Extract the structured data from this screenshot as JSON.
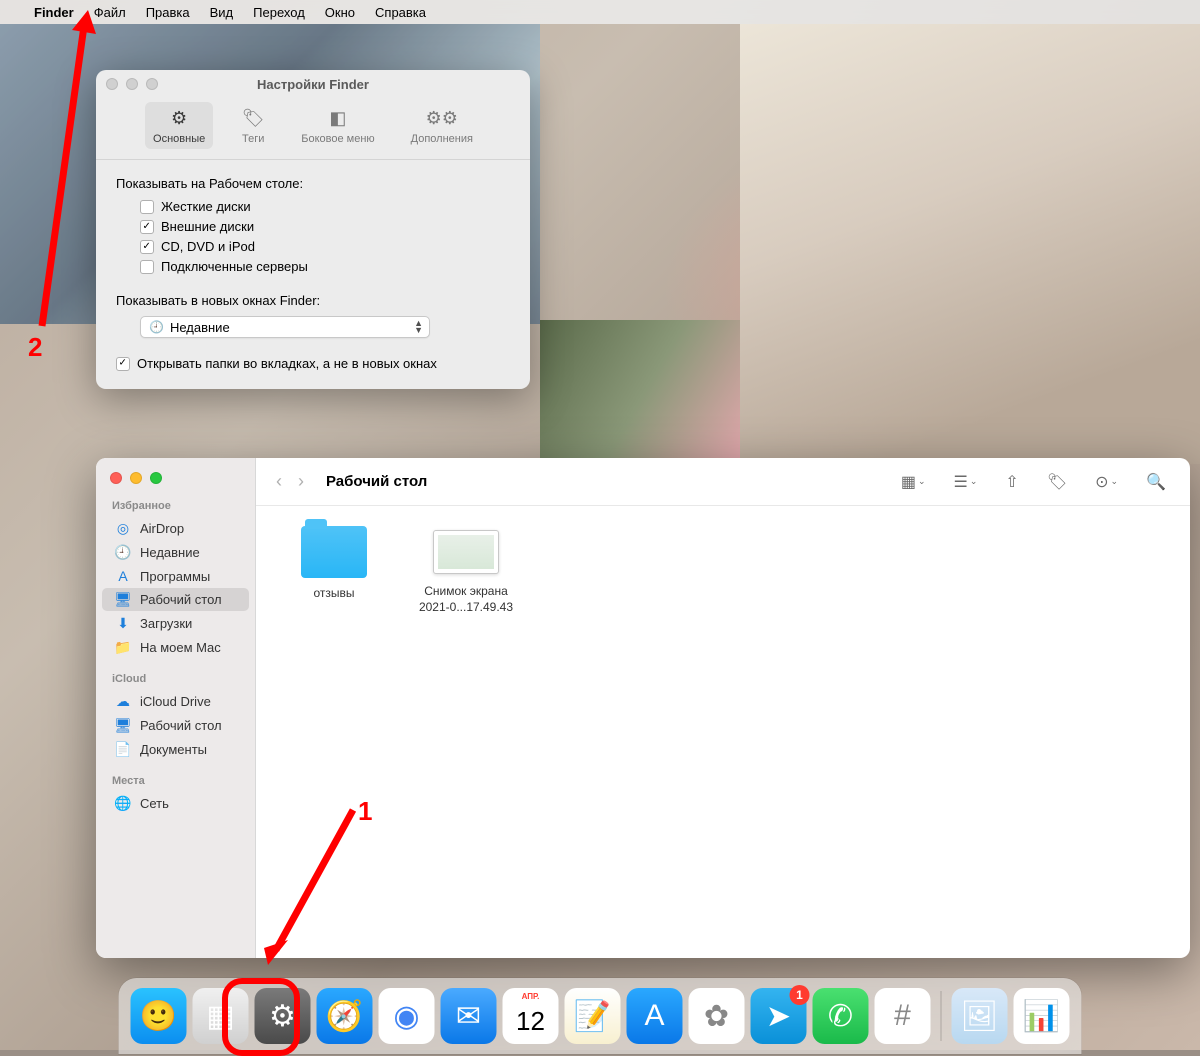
{
  "menubar": {
    "app": "Finder",
    "items": [
      "Файл",
      "Правка",
      "Вид",
      "Переход",
      "Окно",
      "Справка"
    ]
  },
  "prefs": {
    "title": "Настройки Finder",
    "tabs": [
      {
        "id": "general",
        "label": "Основные"
      },
      {
        "id": "tags",
        "label": "Теги"
      },
      {
        "id": "sidebar",
        "label": "Боковое меню"
      },
      {
        "id": "advanced",
        "label": "Дополнения"
      }
    ],
    "show_on_desktop_label": "Показывать на Рабочем столе:",
    "checks": [
      {
        "label": "Жесткие диски",
        "on": false
      },
      {
        "label": "Внешние диски",
        "on": true
      },
      {
        "label": "CD, DVD и iPod",
        "on": true
      },
      {
        "label": "Подключенные серверы",
        "on": false
      }
    ],
    "new_window_label": "Показывать в новых окнах Finder:",
    "new_window_value": "Недавние",
    "tabs_checkbox": "Открывать папки во вкладках, а не в новых окнах"
  },
  "finder": {
    "title": "Рабочий стол",
    "sidebar": {
      "favorites_header": "Избранное",
      "favorites": [
        {
          "icon": "◎",
          "label": "AirDrop"
        },
        {
          "icon": "🕘",
          "label": "Недавние"
        },
        {
          "icon": "A",
          "label": "Программы"
        },
        {
          "icon": "🖥",
          "label": "Рабочий стол",
          "sel": true
        },
        {
          "icon": "⬇",
          "label": "Загрузки"
        },
        {
          "icon": "📁",
          "label": "На моем Mac"
        }
      ],
      "icloud_header": "iCloud",
      "icloud": [
        {
          "icon": "☁",
          "label": "iCloud Drive"
        },
        {
          "icon": "🖥",
          "label": "Рабочий стол"
        },
        {
          "icon": "📄",
          "label": "Документы"
        }
      ],
      "locations_header": "Места",
      "locations": [
        {
          "icon": "🌐",
          "label": "Сеть"
        }
      ]
    },
    "files": [
      {
        "type": "folder",
        "name": "отзывы"
      },
      {
        "type": "image",
        "name": "Снимок экрана 2021-0...17.49.43"
      }
    ]
  },
  "dock": {
    "apps": [
      {
        "id": "finder",
        "bg": "linear-gradient(#2ac2ff,#0b8ef0)",
        "glyph": "🙂"
      },
      {
        "id": "launchpad",
        "bg": "linear-gradient(#f0f0f0,#d0d0d0)",
        "glyph": "▦"
      },
      {
        "id": "settings",
        "bg": "linear-gradient(#7a7a7a,#4a4a4a)",
        "glyph": "⚙"
      },
      {
        "id": "safari",
        "bg": "linear-gradient(#2aa8ff,#0a78e8)",
        "glyph": "🧭"
      },
      {
        "id": "chrome",
        "bg": "#fff",
        "glyph": "◉"
      },
      {
        "id": "mail",
        "bg": "linear-gradient(#4aaaff,#0a78e8)",
        "glyph": "✉"
      },
      {
        "id": "calendar",
        "bg": "#fff",
        "glyph": "12",
        "top": "АПР."
      },
      {
        "id": "notes",
        "bg": "linear-gradient(#fff,#f8f0d0)",
        "glyph": "📝"
      },
      {
        "id": "appstore",
        "bg": "linear-gradient(#2aa8ff,#0a78e8)",
        "glyph": "A"
      },
      {
        "id": "photos",
        "bg": "#fff",
        "glyph": "✿"
      },
      {
        "id": "telegram",
        "bg": "linear-gradient(#34b4f0,#0a90d8)",
        "glyph": "➤",
        "badge": "1"
      },
      {
        "id": "whatsapp",
        "bg": "linear-gradient(#4ae070,#1aba4a)",
        "glyph": "✆"
      },
      {
        "id": "slack",
        "bg": "#fff",
        "glyph": "#"
      }
    ],
    "right": [
      {
        "id": "preview",
        "bg": "linear-gradient(#d8e8f8,#b8d8f0)",
        "glyph": "🖼"
      },
      {
        "id": "numbers",
        "bg": "#fff",
        "glyph": "📊"
      }
    ]
  },
  "annotations": {
    "num1": "1",
    "num2": "2"
  }
}
